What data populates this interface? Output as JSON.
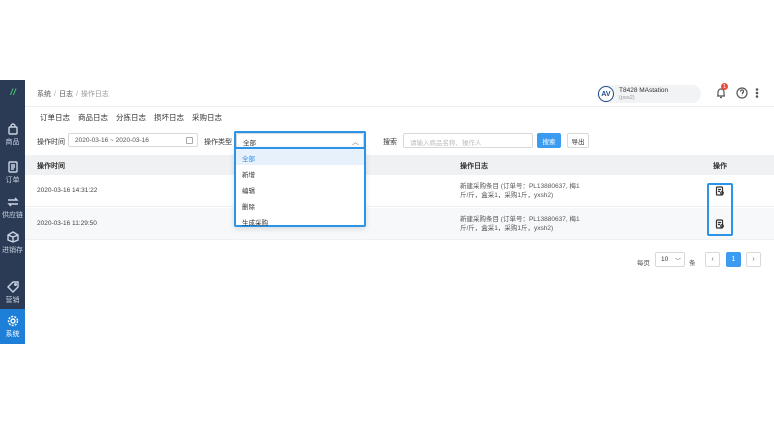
{
  "sidebar": {
    "logo": "/ /",
    "items": [
      {
        "label": "商品",
        "icon": "bag-icon"
      },
      {
        "label": "订单",
        "icon": "document-icon"
      },
      {
        "label": "供应链",
        "icon": "exchange-icon"
      },
      {
        "label": "进销存",
        "icon": "box-icon"
      },
      {
        "label": "营销",
        "icon": "tag-icon"
      },
      {
        "label": "系统",
        "icon": "gear-icon",
        "active": true
      }
    ]
  },
  "header": {
    "breadcrumb": [
      "系统",
      "日志",
      "操作日志"
    ],
    "store_logo": "AV",
    "store_name": "T8428 MAstation",
    "store_code": "(pos2)",
    "notification_count": "1"
  },
  "tabs": [
    "订单日志",
    "商品日志",
    "分拣日志",
    "损坏日志",
    "采购日志"
  ],
  "filters": {
    "time_label": "操作时间",
    "date_range": "2020-03-16 ~ 2020-03-16",
    "type_label": "操作类型",
    "type_value": "全部",
    "search_label": "搜索",
    "search_placeholder": "请输入商品名称、操作人",
    "search_button": "搜索",
    "export_button": "导出"
  },
  "dropdown": {
    "options": [
      "全部",
      "新增",
      "编辑",
      "删除",
      "生成采购"
    ]
  },
  "table": {
    "headers": [
      "操作时间",
      "操作日志",
      "操作"
    ],
    "rows": [
      {
        "time": "2020-03-16 14:31:22",
        "log": "新建采购条目 (订单号：PL13880637, 梅1斤/斤，盒采1，采购1斤，yxsh2)"
      },
      {
        "time": "2020-03-16 11:29:50",
        "log": "新建采购条目 (订单号：PL13880637, 梅1斤/斤，盒采1，采购1斤，yxsh2)"
      }
    ]
  },
  "pagination": {
    "per_page_label": "每页",
    "per_page": "10",
    "unit": "条",
    "prev": "‹",
    "current": "1",
    "next": "›"
  },
  "colors": {
    "sidebar": "#2b3b55",
    "accent": "#3a9bf0",
    "active": "#1e7fd8"
  }
}
